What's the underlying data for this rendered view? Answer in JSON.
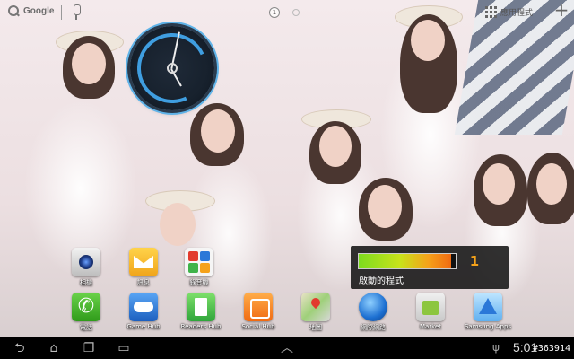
{
  "top_bar": {
    "google_label": "Google",
    "apps_label": "應用程式",
    "active_page": "1",
    "add_label": "+"
  },
  "task_widget": {
    "count": "1",
    "label": "啟動的程式",
    "usage_fraction": 0.95
  },
  "icons": [
    {
      "label": "相機",
      "icon": "camera-icon"
    },
    {
      "label": "訊息",
      "icon": "messages-icon"
    },
    {
      "label": "錄音機",
      "icon": "recorder-icon"
    },
    {
      "label": "電話",
      "icon": "phone-icon"
    },
    {
      "label": "Game Hub",
      "icon": "game-hub-icon"
    },
    {
      "label": "Readers Hub",
      "icon": "readers-hub-icon"
    },
    {
      "label": "Social Hub",
      "icon": "social-hub-icon"
    },
    {
      "label": "地圖",
      "icon": "maps-icon"
    },
    {
      "label": "網際網路",
      "icon": "browser-icon"
    },
    {
      "label": "Market",
      "icon": "market-icon"
    },
    {
      "label": "Samsung Apps",
      "icon": "samsung-apps-icon"
    }
  ],
  "system_bar": {
    "time": "5:01",
    "watermark": "#363914"
  }
}
